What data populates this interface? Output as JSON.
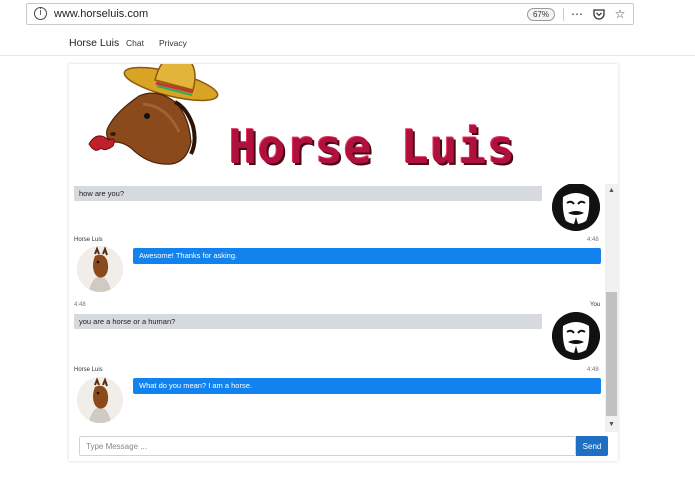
{
  "browser": {
    "url_host": "www.horseluis.com",
    "zoom": "67%",
    "more_icon": "ellipsis-icon",
    "pocket_icon": "pocket-icon",
    "bookmark_icon": "star-icon"
  },
  "nav": {
    "brand": "Horse Luis",
    "links": [
      "Chat",
      "Privacy"
    ]
  },
  "banner": {
    "title": "Horse Luis"
  },
  "chat": {
    "messages": [
      {
        "from": "user",
        "text": "how are you?"
      },
      {
        "from": "bot",
        "name": "Horse Luis",
        "time": "4:48",
        "text": "Awesome! Thanks for asking."
      },
      {
        "from": "user",
        "name": "You",
        "time": "4:48",
        "text": "you are a horse or a human?"
      },
      {
        "from": "bot",
        "name": "Horse Luis",
        "time": "4:48",
        "text": "What do you mean? I am a horse."
      }
    ]
  },
  "composer": {
    "placeholder": "Type Message ...",
    "send_label": "Send"
  },
  "colors": {
    "bot_bubble": "#1283ee",
    "user_bubble": "#d6d9de",
    "send_button": "#1f6fc3",
    "banner_title": "#b0103c"
  }
}
